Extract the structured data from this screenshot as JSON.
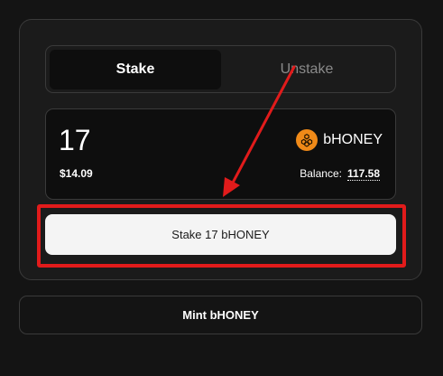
{
  "tabs": {
    "stake_label": "Stake",
    "unstake_label": "Unstake",
    "active": "Stake"
  },
  "amount": {
    "value": "17",
    "usd_value": "$14.09"
  },
  "token": {
    "name": "bHONEY",
    "icon": "honeycomb-icon",
    "icon_color": "#f08a18"
  },
  "balance": {
    "label": "Balance:",
    "value": "117.58"
  },
  "actions": {
    "stake_button_label": "Stake 17 bHONEY",
    "mint_button_label": "Mint bHONEY"
  },
  "annotation": {
    "color": "#e11b1b"
  }
}
